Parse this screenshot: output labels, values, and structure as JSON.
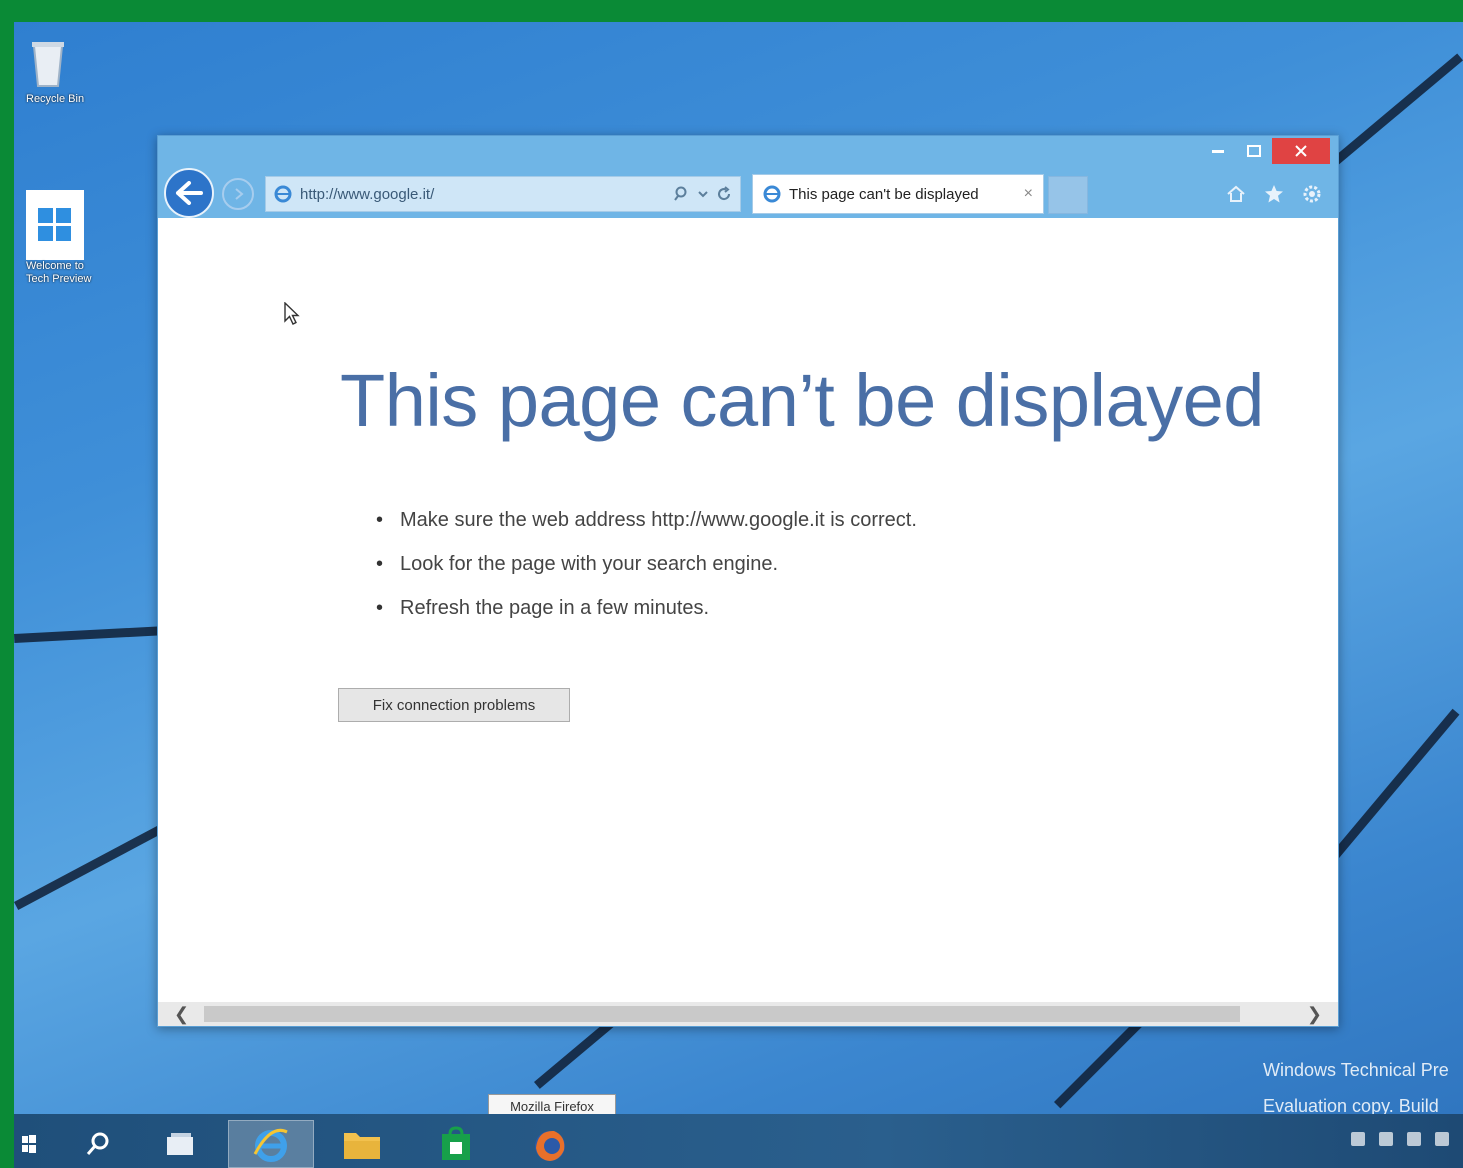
{
  "desktop": {
    "icons": [
      {
        "label": "Recycle Bin"
      },
      {
        "label": "Welcome to Tech Preview"
      }
    ],
    "watermark": {
      "line1": "Windows Technical Pre",
      "line2": "Evaluation copy. Build"
    }
  },
  "browser": {
    "address": "http://www.google.it/",
    "tab_title": "This page can't be displayed",
    "tab_close": "×"
  },
  "page": {
    "title": "This page can’t be displayed",
    "tips": [
      "Make sure the web address http://www.google.it is correct.",
      "Look for the page with your search engine.",
      "Refresh the page in a few minutes."
    ],
    "fix_button": "Fix connection problems"
  },
  "taskbar": {
    "tooltip": "Mozilla Firefox",
    "items": [
      "start",
      "search",
      "task-view",
      "internet-explorer",
      "file-explorer",
      "store",
      "firefox"
    ]
  },
  "colors": {
    "frame": "#0a8a36",
    "title_text": "#4a6fa6",
    "close_button": "#e04343",
    "back_button": "#2d74c9"
  }
}
